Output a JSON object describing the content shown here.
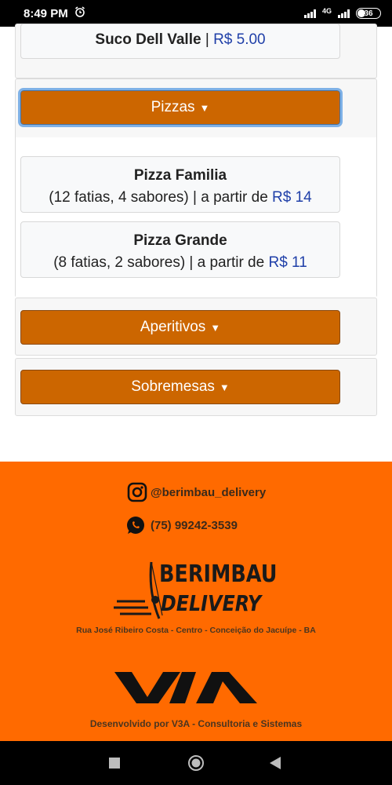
{
  "status_bar": {
    "time": "8:49 PM",
    "network_label": "4G",
    "battery": "36"
  },
  "menu": {
    "top_item": {
      "name": "Suco Dell Valle",
      "separator": " | ",
      "price": "R$ 5.00"
    },
    "categories": [
      {
        "label": "Pizzas",
        "expanded": true
      },
      {
        "label": "Aperitivos",
        "expanded": false
      },
      {
        "label": "Sobremesas",
        "expanded": false
      }
    ],
    "pizzas": [
      {
        "name": "Pizza Familia",
        "description": "(12 fatias, 4 sabores) | a partir de ",
        "price": "R$ 14"
      },
      {
        "name": "Pizza Grande",
        "description": "(8 fatias, 2 sabores) | a partir de ",
        "price": "R$ 11"
      }
    ]
  },
  "footer": {
    "instagram": "@berimbau_delivery",
    "whatsapp": "(75) 99242-3539",
    "logo_line1": "BERIMBAU",
    "logo_line2": "DELIVERY",
    "address": "Rua José Ribeiro Costa - Centro - Conceição do Jacuípe - BA",
    "dev_credit": "Desenvolvido por V3A - Consultoria e Sistemas",
    "background_color": "#ff6a00",
    "button_color": "#cc6600"
  }
}
